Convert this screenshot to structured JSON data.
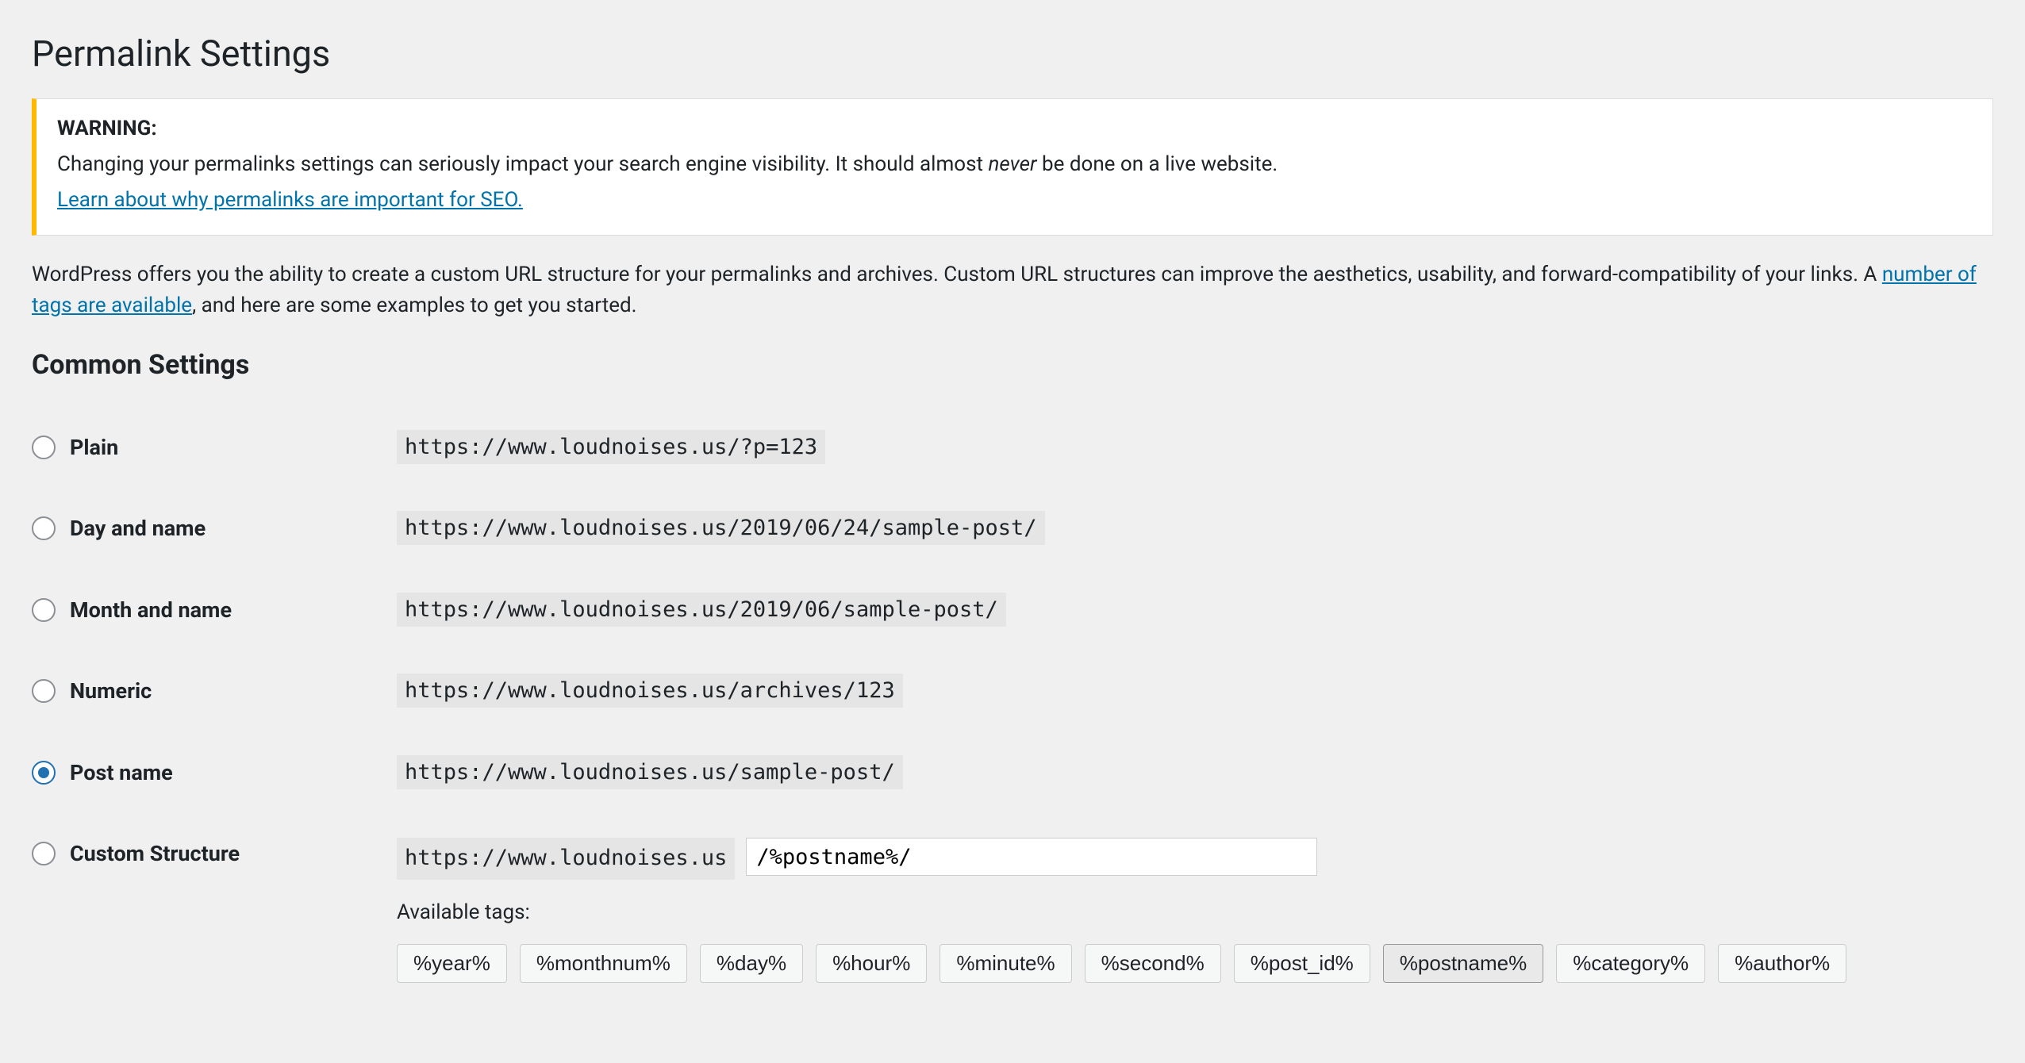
{
  "page": {
    "title": "Permalink Settings"
  },
  "notice": {
    "heading": "WARNING:",
    "line_pre": "Changing your permalinks settings can seriously impact your search engine visibility. It should almost ",
    "line_em": "never",
    "line_post": " be done on a live website.",
    "link": "Learn about why permalinks are important for SEO."
  },
  "description": {
    "pre": "WordPress offers you the ability to create a custom URL structure for your permalinks and archives. Custom URL structures can improve the aesthetics, usability, and forward-compatibility of your links. A ",
    "link": "number of tags are available",
    "post": ", and here are some examples to get you started."
  },
  "section": {
    "title": "Common Settings"
  },
  "options": {
    "plain": {
      "label": "Plain",
      "example": "https://www.loudnoises.us/?p=123"
    },
    "day": {
      "label": "Day and name",
      "example": "https://www.loudnoises.us/2019/06/24/sample-post/"
    },
    "month": {
      "label": "Month and name",
      "example": "https://www.loudnoises.us/2019/06/sample-post/"
    },
    "numeric": {
      "label": "Numeric",
      "example": "https://www.loudnoises.us/archives/123"
    },
    "post": {
      "label": "Post name",
      "example": "https://www.loudnoises.us/sample-post/"
    },
    "custom": {
      "label": "Custom Structure",
      "base": "https://www.loudnoises.us",
      "value": "/%postname%/"
    }
  },
  "available": {
    "label": "Available tags:",
    "tags": [
      {
        "text": "%year%",
        "active": false
      },
      {
        "text": "%monthnum%",
        "active": false
      },
      {
        "text": "%day%",
        "active": false
      },
      {
        "text": "%hour%",
        "active": false
      },
      {
        "text": "%minute%",
        "active": false
      },
      {
        "text": "%second%",
        "active": false
      },
      {
        "text": "%post_id%",
        "active": false
      },
      {
        "text": "%postname%",
        "active": true
      },
      {
        "text": "%category%",
        "active": false
      },
      {
        "text": "%author%",
        "active": false
      }
    ]
  }
}
